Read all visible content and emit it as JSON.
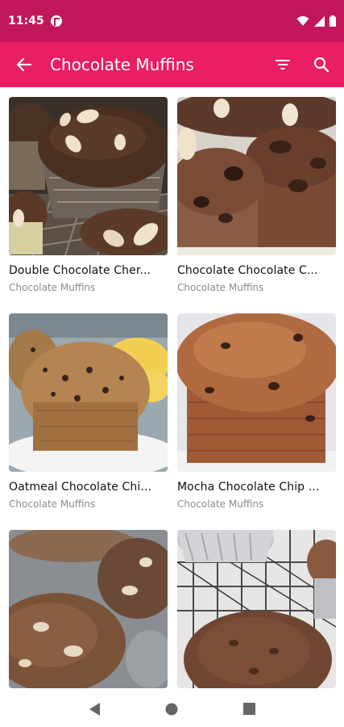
{
  "status_bar": {
    "time": "11:45"
  },
  "app_bar": {
    "title": "Chocolate Muffins",
    "back_icon": "arrow-back-icon",
    "filter_icon": "filter-icon",
    "search_icon": "search-icon"
  },
  "colors": {
    "status_bar": "#c2185b",
    "app_bar": "#e91e63"
  },
  "recipes": [
    {
      "title": "Double Chocolate Cher...",
      "category": "Chocolate Muffins"
    },
    {
      "title": "Chocolate Chocolate C...",
      "category": "Chocolate Muffins"
    },
    {
      "title": "Oatmeal Chocolate Chi...",
      "category": "Chocolate Muffins"
    },
    {
      "title": "Mocha Chocolate Chip ...",
      "category": "Chocolate Muffins"
    },
    {
      "title": "",
      "category": ""
    },
    {
      "title": "",
      "category": ""
    }
  ]
}
